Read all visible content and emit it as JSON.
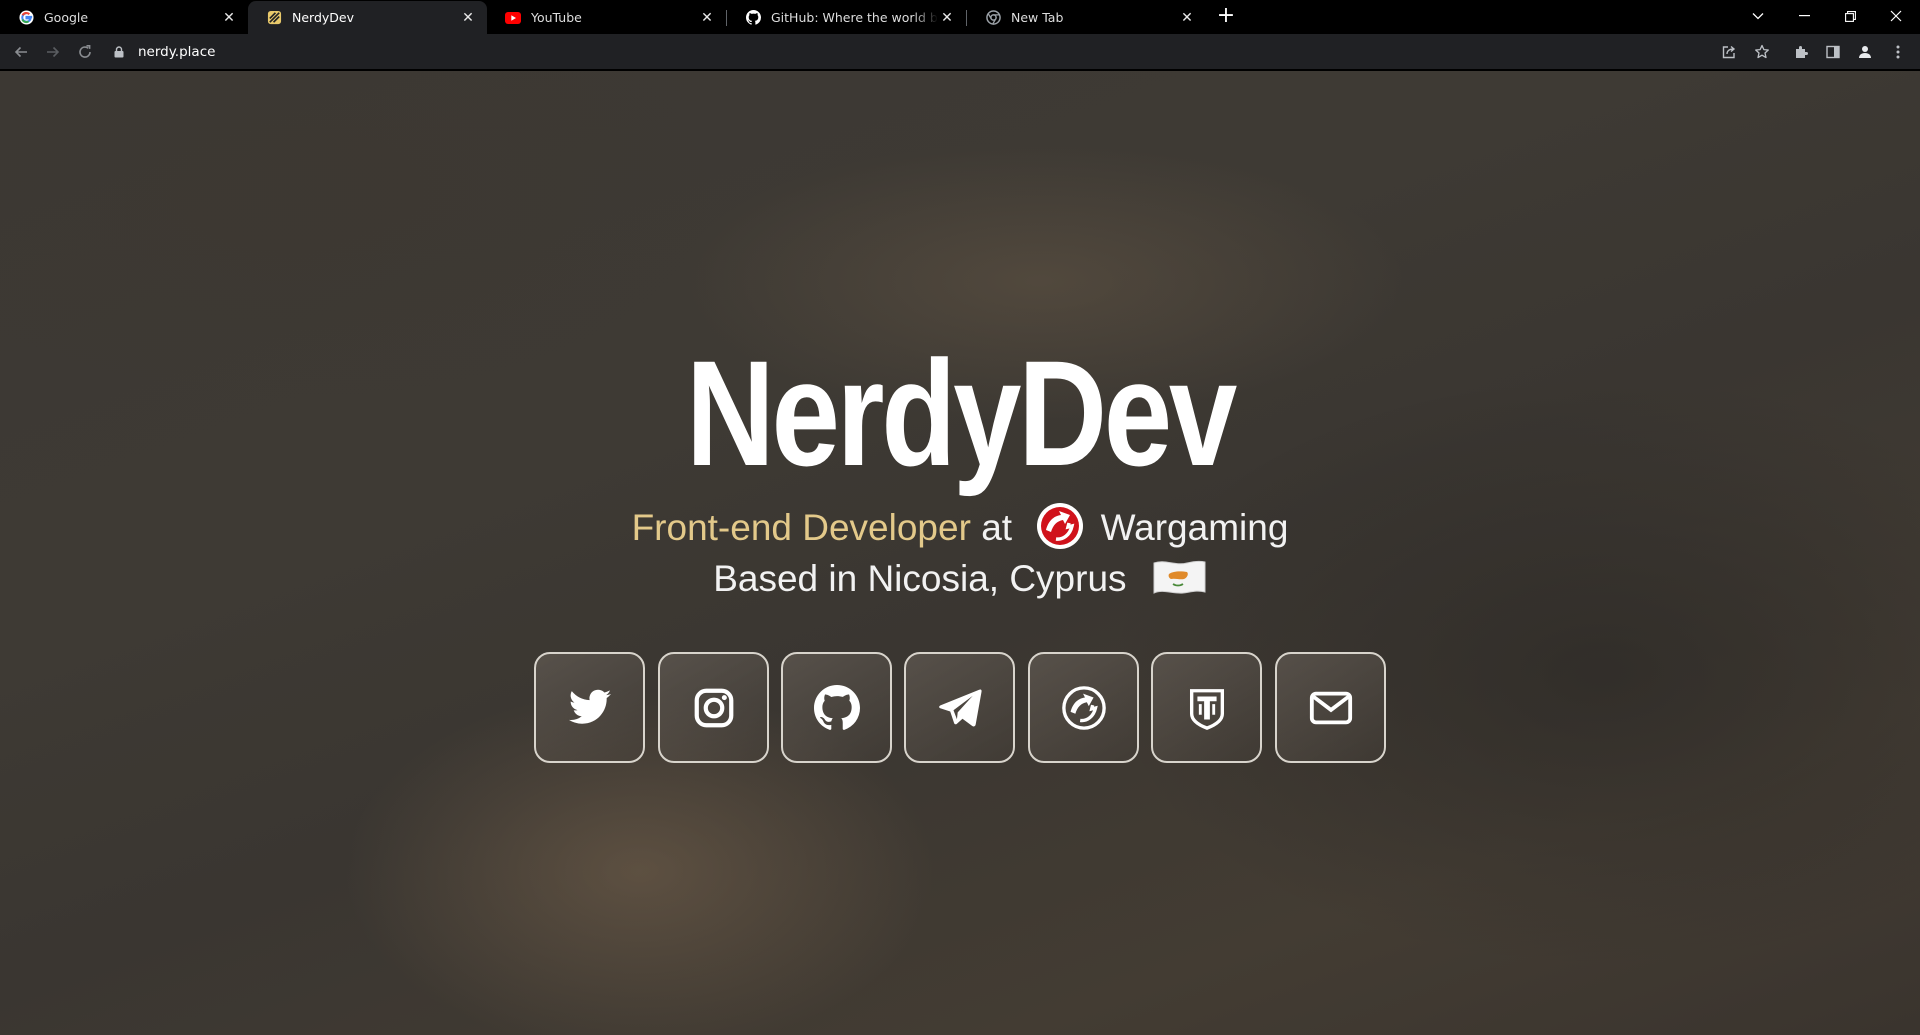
{
  "browser": {
    "tabs": [
      {
        "title": "Google",
        "icon": "google-icon"
      },
      {
        "title": "NerdyDev",
        "icon": "nerdydev-icon",
        "active": true
      },
      {
        "title": "YouTube",
        "icon": "youtube-icon"
      },
      {
        "title": "GitHub: Where the world builds s",
        "icon": "github-icon"
      },
      {
        "title": "New Tab",
        "icon": "chrome-icon"
      }
    ],
    "tab_close_glyph": "✕",
    "new_tab_glyph": "+",
    "url": "nerdy.place"
  },
  "page": {
    "title": "NerdyDev",
    "role": "Front-end Developer",
    "at": "at",
    "company": "Wargaming",
    "location": "Based in Nicosia, Cyprus",
    "flag_icon": "cyprus-flag-icon",
    "accent_color": "#e3c98a",
    "social_links": [
      {
        "icon": "twitter-icon"
      },
      {
        "icon": "instagram-icon"
      },
      {
        "icon": "github-icon"
      },
      {
        "icon": "telegram-icon"
      },
      {
        "icon": "wargaming-icon"
      },
      {
        "icon": "world-of-tanks-icon"
      },
      {
        "icon": "email-icon"
      }
    ]
  }
}
